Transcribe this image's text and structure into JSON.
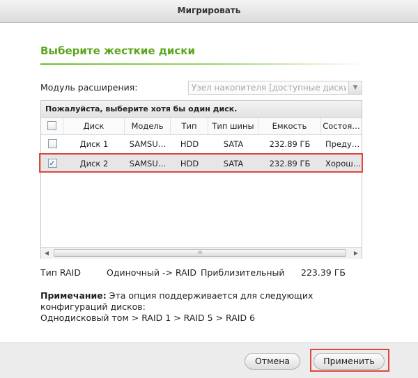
{
  "window": {
    "title": "Мигрировать"
  },
  "section": {
    "heading": "Выберите жесткие диски"
  },
  "expansion": {
    "label": "Модуль расширения:",
    "selected": "Узел накопителя [доступные диски",
    "arrow_icon": "chevron-down-icon"
  },
  "grid": {
    "caption": "Пожалуйста, выберите хотя бы один диск.",
    "columns": [
      "Диск",
      "Модель",
      "Тип",
      "Тип шины",
      "Емкость",
      "Состоя…"
    ],
    "rows": [
      {
        "checked": false,
        "disk": "Диск 1",
        "model": "SAMSU…",
        "type": "HDD",
        "bus": "SATA",
        "capacity": "232.89 ГБ",
        "status": "Преду…"
      },
      {
        "checked": true,
        "disk": "Диск 2",
        "model": "SAMSU…",
        "type": "HDD",
        "bus": "SATA",
        "capacity": "232.89 ГБ",
        "status": "Хорош…"
      }
    ],
    "scroll": {
      "left_arrow": "◀",
      "right_arrow": "▶",
      "grip": "III"
    }
  },
  "raid": {
    "label": "Тип RAID",
    "value": "Одиночный -> RAID",
    "approx_label": "Приблизительный",
    "approx_value": "223.39 ГБ"
  },
  "note": {
    "label": "Примечание:",
    "text": "Эта опция поддерживается для следующих конфигураций дисков:",
    "path": "Однодисковый том > RAID 1 > RAID 5 > RAID 6"
  },
  "buttons": {
    "cancel": "Отмена",
    "apply": "Применить"
  },
  "colors": {
    "accent_green": "#5aa61a",
    "highlight_red": "#e0463d",
    "selected_row": "#e6e6e6"
  }
}
